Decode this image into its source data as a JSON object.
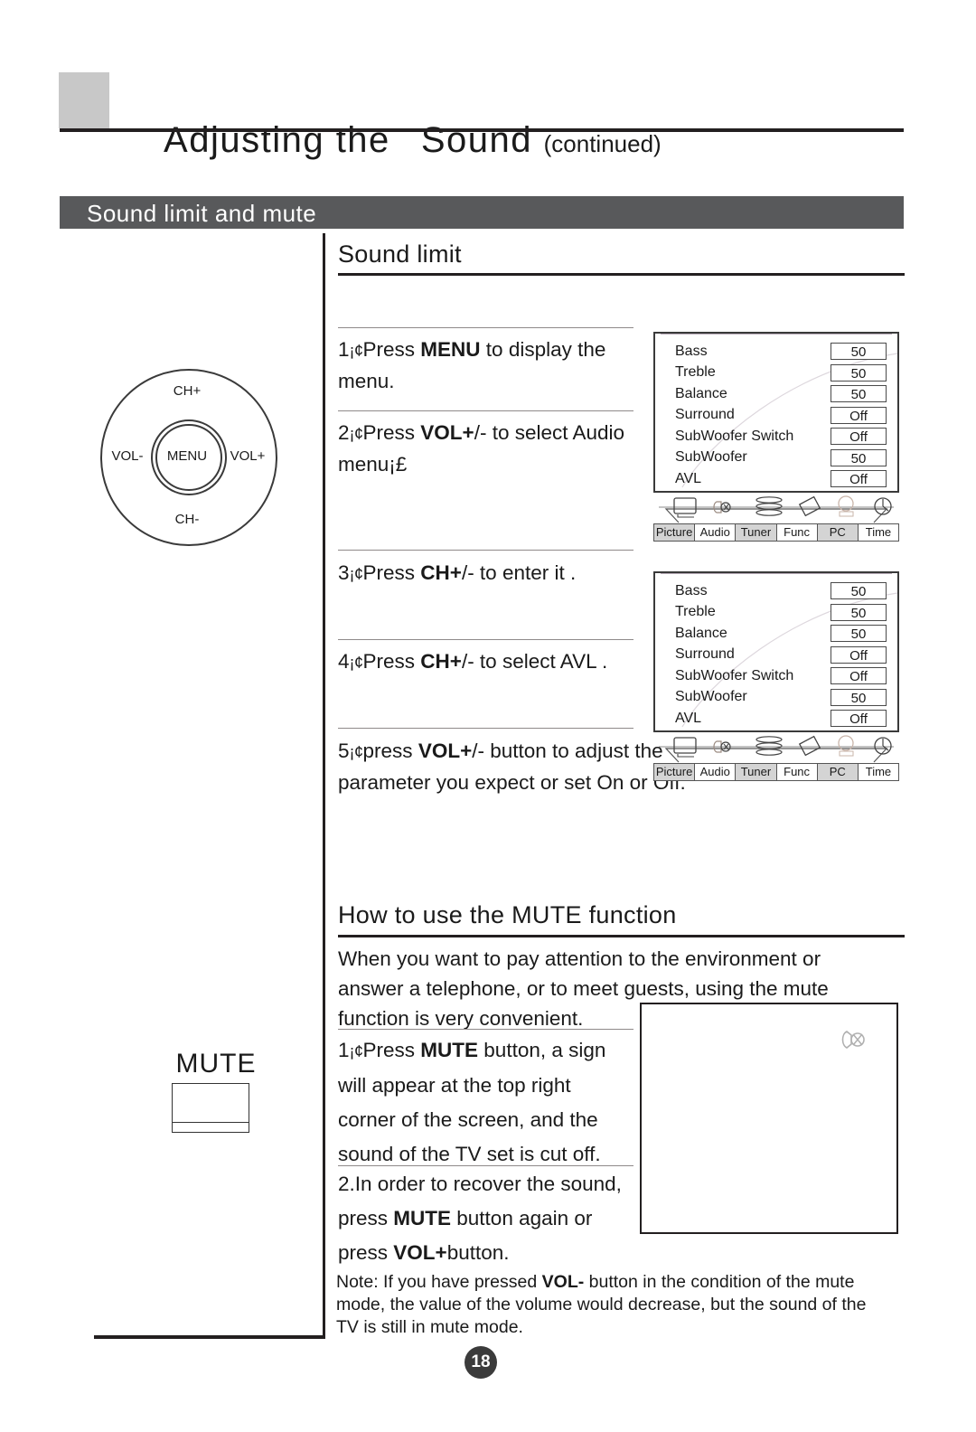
{
  "header": {
    "title_main": "Adjusting the",
    "title_sound": "Sound",
    "title_continued": "(continued)"
  },
  "section": {
    "band_label": "Sound limit and mute"
  },
  "control_pad": {
    "ch_plus": "CH+",
    "ch_minus": "CH-",
    "vol_minus": "VOL-",
    "vol_plus": "VOL+",
    "menu": "MENU"
  },
  "sound_limit": {
    "heading": "Sound limit",
    "steps": [
      {
        "num": "1",
        "sep": "¡¢",
        "pre": "Press ",
        "key": "MENU",
        "post": " to display the menu."
      },
      {
        "num": "2",
        "sep": "¡¢",
        "pre": "Press ",
        "key": "VOL+",
        "post": "/- to select Audio menu¡£"
      },
      {
        "num": "3",
        "sep": "¡¢",
        "pre": "Press ",
        "key": "CH+",
        "post": "/- to enter it ."
      },
      {
        "num": "4",
        "sep": "¡¢",
        "pre": "Press ",
        "key": "CH+",
        "post": "/- to select AVL ."
      },
      {
        "num": "5",
        "sep": "¡¢",
        "pre": "press ",
        "key": "VOL+",
        "post": "/- button to adjust the parameter you expect or set On or Off."
      }
    ]
  },
  "osd": {
    "rows": [
      {
        "label": "Bass",
        "value": "50"
      },
      {
        "label": "Treble",
        "value": "50"
      },
      {
        "label": "Balance",
        "value": "50"
      },
      {
        "label": "Surround",
        "value": "Off"
      },
      {
        "label": "SubWoofer Switch",
        "value": "Off"
      },
      {
        "label": "SubWoofer",
        "value": "50"
      },
      {
        "label": "AVL",
        "value": "Off"
      }
    ],
    "tabs": [
      {
        "label": "Picture",
        "icon": "monitor-icon",
        "shaded": true
      },
      {
        "label": "Audio",
        "icon": "speaker-icon",
        "shaded": false
      },
      {
        "label": "Tuner",
        "icon": "stack-icon",
        "shaded": true
      },
      {
        "label": "Func",
        "icon": "diamond-icon",
        "shaded": false
      },
      {
        "label": "PC",
        "icon": "computer-icon",
        "shaded": true
      },
      {
        "label": "Time",
        "icon": "clock-icon",
        "shaded": false
      }
    ]
  },
  "mute": {
    "heading": "How to use the MUTE function",
    "intro": "When you want to pay attention to the environment or answer a telephone, or to meet guests, using the mute function is very convenient.",
    "steps": [
      {
        "num": "1",
        "sep": "¡¢",
        "pre": "Press ",
        "key": "MUTE",
        "post": " button, a sign will appear at the top right corner of the screen, and the sound of the TV set is cut off."
      },
      {
        "num": "2.",
        "sep": "",
        "pre": "In order to recover the sound, press ",
        "key": "MUTE",
        "post": " button again or press ",
        "key2": "VOL+",
        "post2": "button."
      }
    ],
    "button_label": "MUTE",
    "sign_icon": "mute-speaker-icon"
  },
  "note": {
    "pre": "Note: If you have pressed ",
    "key": "VOL-",
    "post": " button in the condition of the mute mode, the value of the volume would decrease, but the sound of the TV is still in mute mode."
  },
  "footer": {
    "page_number": "18"
  },
  "colors": {
    "band": "#58595b",
    "header_square": "#c8c8c8",
    "rule": "#231f20",
    "page_badge": "#3b3b3b"
  }
}
